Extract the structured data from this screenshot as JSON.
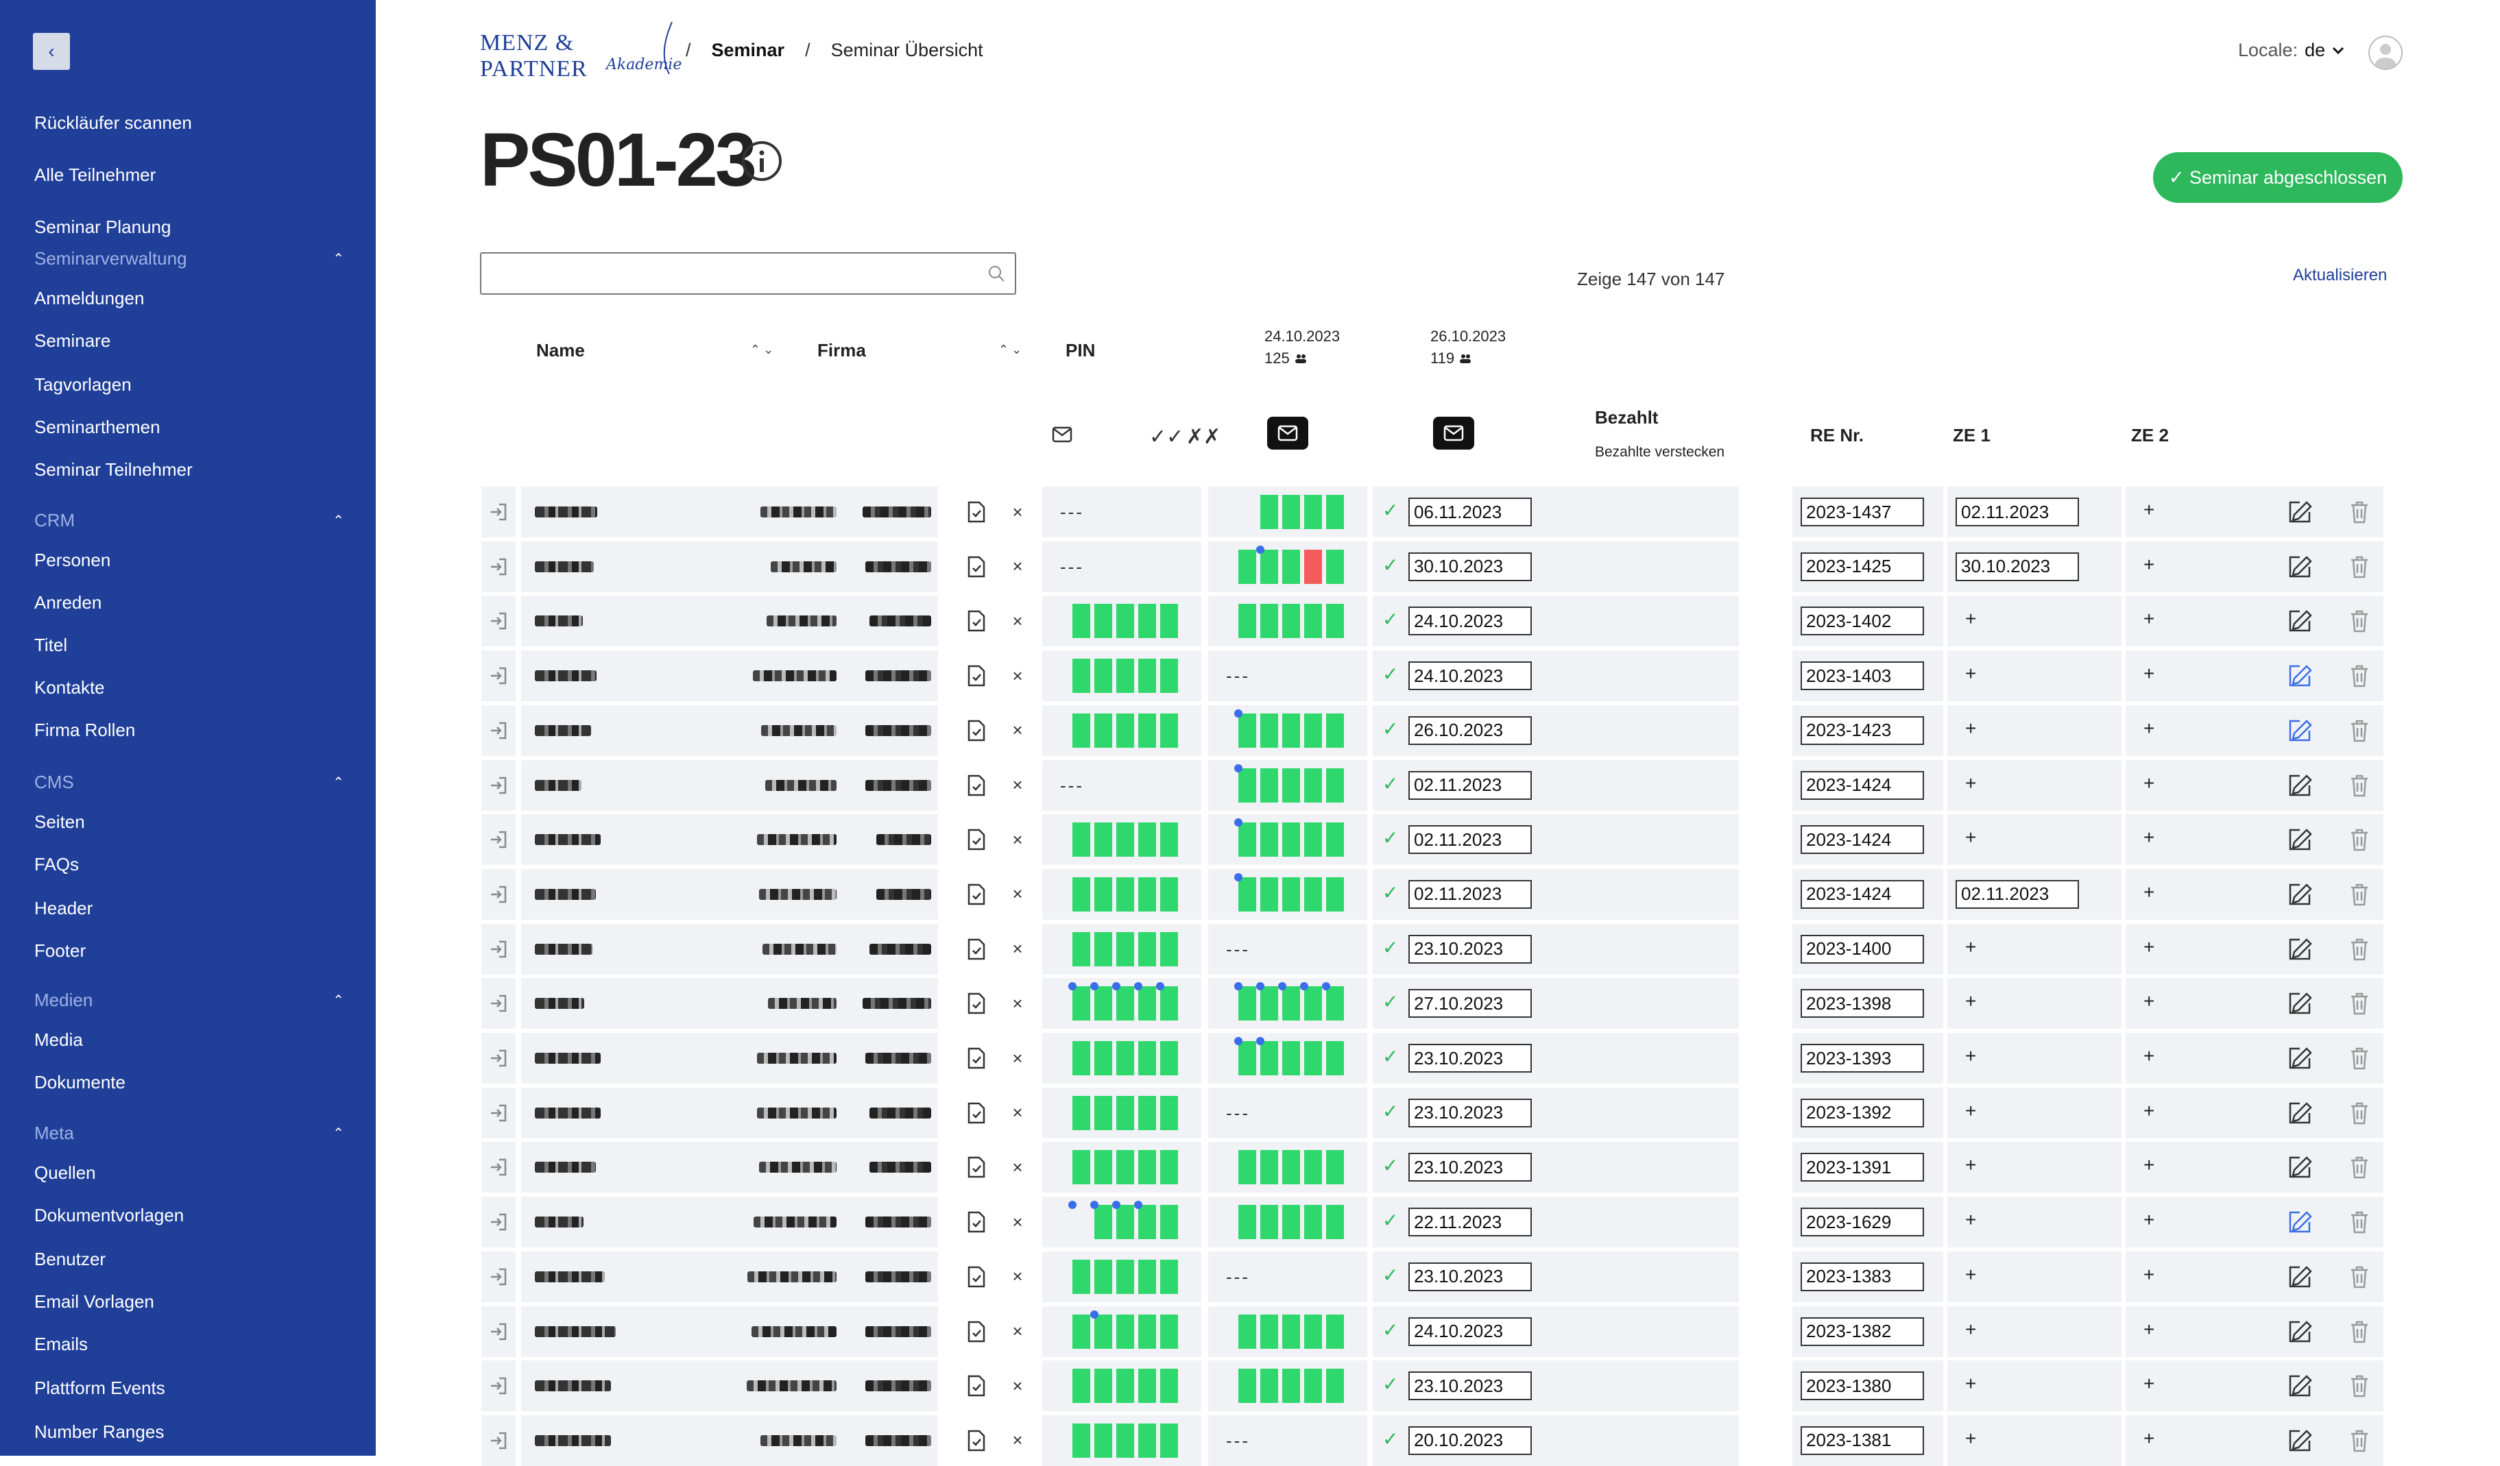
{
  "sidebar": {
    "collapse_icon": "chevron-left-icon",
    "items": [
      {
        "type": "link",
        "label": "Rückläufer scannen"
      },
      {
        "type": "link",
        "label": "Alle Teilnehmer"
      },
      {
        "type": "link",
        "label": "Seminar Planung"
      },
      {
        "type": "section",
        "label": "Seminarverwaltung"
      },
      {
        "type": "link",
        "label": "Anmeldungen"
      },
      {
        "type": "link",
        "label": "Seminare"
      },
      {
        "type": "link",
        "label": "Tagvorlagen"
      },
      {
        "type": "link",
        "label": "Seminarthemen"
      },
      {
        "type": "link",
        "label": "Seminar Teilnehmer"
      },
      {
        "type": "section",
        "label": "CRM"
      },
      {
        "type": "link",
        "label": "Personen"
      },
      {
        "type": "link",
        "label": "Anreden"
      },
      {
        "type": "link",
        "label": "Titel"
      },
      {
        "type": "link",
        "label": "Kontakte"
      },
      {
        "type": "link",
        "label": "Firma Rollen"
      },
      {
        "type": "section",
        "label": "CMS"
      },
      {
        "type": "link",
        "label": "Seiten"
      },
      {
        "type": "link",
        "label": "FAQs"
      },
      {
        "type": "link",
        "label": "Header"
      },
      {
        "type": "link",
        "label": "Footer"
      },
      {
        "type": "section",
        "label": "Medien"
      },
      {
        "type": "link",
        "label": "Media"
      },
      {
        "type": "link",
        "label": "Dokumente"
      },
      {
        "type": "section",
        "label": "Meta"
      },
      {
        "type": "link",
        "label": "Quellen"
      },
      {
        "type": "link",
        "label": "Dokumentvorlagen"
      },
      {
        "type": "link",
        "label": "Benutzer"
      },
      {
        "type": "link",
        "label": "Email Vorlagen"
      },
      {
        "type": "link",
        "label": "Emails"
      },
      {
        "type": "link",
        "label": "Plattform Events"
      },
      {
        "type": "link",
        "label": "Number Ranges"
      }
    ]
  },
  "header": {
    "logo_line1": "MENZ & PARTNER",
    "logo_line2": "Akademie",
    "breadcrumb": [
      "Seminar",
      "Seminar Übersicht"
    ],
    "breadcrumb_sep": "/",
    "locale_label": "Locale:",
    "locale_value": "de"
  },
  "page": {
    "title": "PS01-23",
    "status_button": "✓ Seminar abgeschlossen",
    "search_placeholder": "",
    "count_text": "Zeige 147 von 147",
    "refresh_label": "Aktualisieren"
  },
  "table": {
    "headers": {
      "name": "Name",
      "firma": "Firma",
      "pin": "PIN",
      "bezahlt": "Bezahlt",
      "bezahlt_hide": "Bezahlte verstecken",
      "re_nr": "RE Nr.",
      "ze1": "ZE 1",
      "ze2": "ZE 2"
    },
    "days": [
      {
        "date": "24.10.2023",
        "count": "125"
      },
      {
        "date": "26.10.2023",
        "count": "119"
      }
    ],
    "accent_green": "#2fd86d",
    "accent_blue": "#3a6ee8",
    "accent_red": "#f25c5c",
    "rows": [
      {
        "day1": "---",
        "day2": [
          0,
          1,
          1,
          1,
          1
        ],
        "d2dots": [],
        "d2red": [],
        "paid": "06.11.2023",
        "re": "2023-1437",
        "ze1": "02.11.2023",
        "ze2": "+",
        "edit_blue": false
      },
      {
        "day1": "---",
        "day2": [
          1,
          1,
          1,
          1,
          1
        ],
        "d2dots": [
          2
        ],
        "d2red": [
          3
        ],
        "paid": "30.10.2023",
        "re": "2023-1425",
        "ze1": "30.10.2023",
        "ze2": "+",
        "edit_blue": false
      },
      {
        "day1": [
          1,
          1,
          1,
          1,
          1
        ],
        "d1dots": [],
        "day2": [
          1,
          1,
          1,
          1,
          1
        ],
        "d2dots": [],
        "paid": "24.10.2023",
        "re": "2023-1402",
        "ze1": "+",
        "ze2": "+",
        "edit_blue": false
      },
      {
        "day1": [
          1,
          1,
          1,
          1,
          1
        ],
        "d1dots": [],
        "day2": "---",
        "paid": "24.10.2023",
        "re": "2023-1403",
        "ze1": "+",
        "ze2": "+",
        "edit_blue": true
      },
      {
        "day1": [
          1,
          1,
          1,
          1,
          1
        ],
        "d1dots": [],
        "day2": [
          1,
          1,
          1,
          1,
          1
        ],
        "d2dots": [
          1
        ],
        "paid": "26.10.2023",
        "re": "2023-1423",
        "ze1": "+",
        "ze2": "+",
        "edit_blue": true
      },
      {
        "day1": "---",
        "day2": [
          1,
          1,
          1,
          1,
          1
        ],
        "d2dots": [
          1
        ],
        "paid": "02.11.2023",
        "re": "2023-1424",
        "ze1": "+",
        "ze2": "+",
        "edit_blue": false
      },
      {
        "day1": [
          1,
          1,
          1,
          1,
          1
        ],
        "d1dots": [],
        "day2": [
          1,
          1,
          1,
          1,
          1
        ],
        "d2dots": [
          1
        ],
        "paid": "02.11.2023",
        "re": "2023-1424",
        "ze1": "+",
        "ze2": "+",
        "edit_blue": false
      },
      {
        "day1": [
          1,
          1,
          1,
          1,
          1
        ],
        "d1dots": [],
        "day2": [
          1,
          1,
          1,
          1,
          1
        ],
        "d2dots": [
          1
        ],
        "paid": "02.11.2023",
        "re": "2023-1424",
        "ze1": "02.11.2023",
        "ze2": "+",
        "edit_blue": false
      },
      {
        "day1": [
          1,
          1,
          1,
          1,
          1
        ],
        "d1dots": [],
        "day2": "---",
        "paid": "23.10.2023",
        "re": "2023-1400",
        "ze1": "+",
        "ze2": "+",
        "edit_blue": false
      },
      {
        "day1": [
          1,
          1,
          1,
          1,
          1
        ],
        "d1dots": [
          1,
          2,
          3,
          4,
          5
        ],
        "day2": [
          1,
          1,
          1,
          1,
          1
        ],
        "d2dots": [
          1,
          2,
          3,
          4,
          5
        ],
        "paid": "27.10.2023",
        "re": "2023-1398",
        "ze1": "+",
        "ze2": "+",
        "edit_blue": false
      },
      {
        "day1": [
          1,
          1,
          1,
          1,
          1
        ],
        "d1dots": [
          0
        ],
        "day2": [
          1,
          1,
          1,
          1,
          1
        ],
        "d2dots": [
          1,
          2
        ],
        "paid": "23.10.2023",
        "re": "2023-1393",
        "ze1": "+",
        "ze2": "+",
        "edit_blue": false
      },
      {
        "day1": [
          1,
          1,
          1,
          1,
          1
        ],
        "d1dots": [
          0
        ],
        "day2": "---",
        "paid": "23.10.2023",
        "re": "2023-1392",
        "ze1": "+",
        "ze2": "+",
        "edit_blue": false
      },
      {
        "day1": [
          1,
          1,
          1,
          1,
          1
        ],
        "d1dots": [],
        "day2": [
          1,
          1,
          1,
          1,
          1
        ],
        "d2dots": [],
        "paid": "23.10.2023",
        "re": "2023-1391",
        "ze1": "+",
        "ze2": "+",
        "edit_blue": false
      },
      {
        "day1": [
          0,
          1,
          1,
          1,
          1
        ],
        "d1dots": [
          1,
          2,
          3,
          4
        ],
        "day2": [
          1,
          1,
          1,
          1,
          1
        ],
        "d2dots": [],
        "paid": "22.11.2023",
        "re": "2023-1629",
        "ze1": "+",
        "ze2": "+",
        "edit_blue": true
      },
      {
        "day1": [
          1,
          1,
          1,
          1,
          1
        ],
        "d1dots": [
          0
        ],
        "day2": "---",
        "paid": "23.10.2023",
        "re": "2023-1383",
        "ze1": "+",
        "ze2": "+",
        "edit_blue": false
      },
      {
        "day1": [
          1,
          1,
          1,
          1,
          1
        ],
        "d1dots": [
          2
        ],
        "day2": [
          1,
          1,
          1,
          1,
          1
        ],
        "d2dots": [],
        "paid": "24.10.2023",
        "re": "2023-1382",
        "ze1": "+",
        "ze2": "+",
        "edit_blue": false
      },
      {
        "day1": [
          1,
          1,
          1,
          1,
          1
        ],
        "d1dots": [],
        "day2": [
          1,
          1,
          1,
          1,
          1
        ],
        "d2dots": [],
        "paid": "23.10.2023",
        "re": "2023-1380",
        "ze1": "+",
        "ze2": "+",
        "edit_blue": false
      },
      {
        "day1": [
          1,
          1,
          1,
          1,
          1
        ],
        "d1dots": [],
        "day2": "---",
        "paid": "20.10.2023",
        "re": "2023-1381",
        "ze1": "+",
        "ze2": "+",
        "edit_blue": false
      }
    ]
  }
}
